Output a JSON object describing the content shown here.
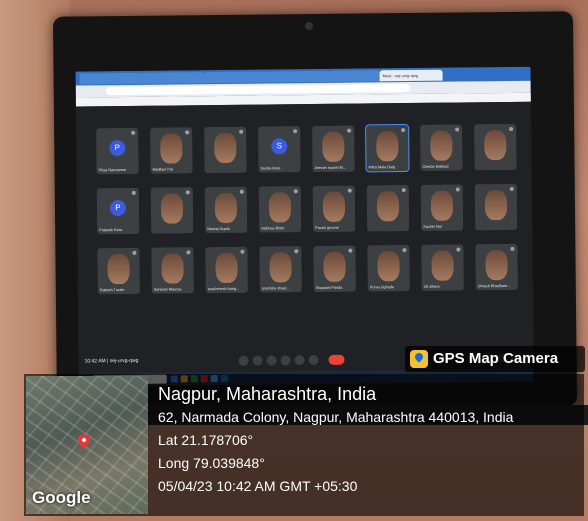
{
  "gps": {
    "app_name": "GPS Map Camera",
    "location": "Nagpur, Maharashtra, India",
    "address": "62, Narmada Colony, Nagpur, Maharashtra 440013, India",
    "lat": "Lat 21.178706°",
    "long": "Long 79.039848°",
    "datetime": "05/04/23 10:42 AM GMT +05:30",
    "map_brand": "Google"
  },
  "meet": {
    "time_code": "10:42 AM | sej-urvg-qwg",
    "participants": [
      {
        "name": "Priya Narnavare",
        "avatar": "P"
      },
      {
        "name": "Madhuri Pal"
      },
      {
        "name": ""
      },
      {
        "name": "Sunita Bora",
        "avatar": "S"
      },
      {
        "name": "Jeevan swami M..."
      },
      {
        "name": "Mitra Mala Baig",
        "highlight": true
      },
      {
        "name": "Chetan Bakkad"
      },
      {
        "name": ""
      },
      {
        "name": "Prakash Bora",
        "avatar": "P"
      },
      {
        "name": ""
      },
      {
        "name": "Neeraj Gupta"
      },
      {
        "name": "Vaibhav Bhim"
      },
      {
        "name": "Pavan groone"
      },
      {
        "name": ""
      },
      {
        "name": "Sachin Nar"
      },
      {
        "name": ""
      },
      {
        "name": "Rakesh Turale"
      },
      {
        "name": "Santosh Maurya"
      },
      {
        "name": "prashmesh bang..."
      },
      {
        "name": "prashika shast..."
      },
      {
        "name": "Swayam Panda"
      },
      {
        "name": "Purva Ughade"
      },
      {
        "name": "20 others"
      },
      {
        "name": "Umesh Bhadham..."
      }
    ]
  },
  "browser": {
    "tab_active": "Meet - sej-urvg-qwg"
  },
  "taskbar": {
    "search_placeholder": "Type here to search"
  }
}
